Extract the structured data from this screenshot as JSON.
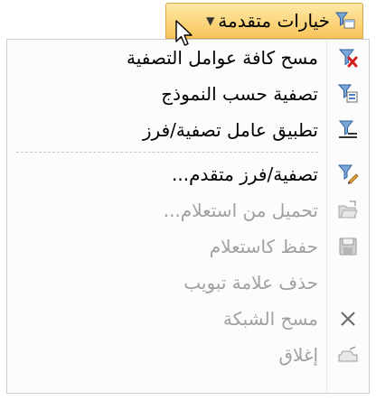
{
  "dropdown": {
    "label": "خيارات متقدمة",
    "chevron": "▼",
    "icon": "filter-options-icon"
  },
  "menu": {
    "items": [
      {
        "label": "مسح كافة عوامل التصفية",
        "icon": "clear-filter-icon",
        "enabled": true
      },
      {
        "label": "تصفية حسب النموذج",
        "icon": "filter-by-form-icon",
        "enabled": true
      },
      {
        "label": "تطبيق عامل تصفية/فرز",
        "icon": "apply-filter-icon",
        "enabled": true
      },
      {
        "label": "تصفية/فرز متقدم...",
        "icon": "advanced-filter-icon",
        "enabled": true
      },
      {
        "label": "تحميل من استعلام...",
        "icon": "load-from-query-icon",
        "enabled": false
      },
      {
        "label": "حفظ كاستعلام",
        "icon": "save-icon",
        "enabled": false
      },
      {
        "label": "حذف علامة تبويب",
        "icon": "",
        "enabled": false
      },
      {
        "label": "مسح الشبكة",
        "icon": "clear-grid-icon",
        "enabled": false
      },
      {
        "label": "إغلاق",
        "icon": "close-icon",
        "enabled": false
      }
    ]
  },
  "colors": {
    "button_top": "#fde9a7",
    "button_bottom": "#f8c55a",
    "disabled_text": "#a0a0a0",
    "clear_red": "#d42020"
  }
}
